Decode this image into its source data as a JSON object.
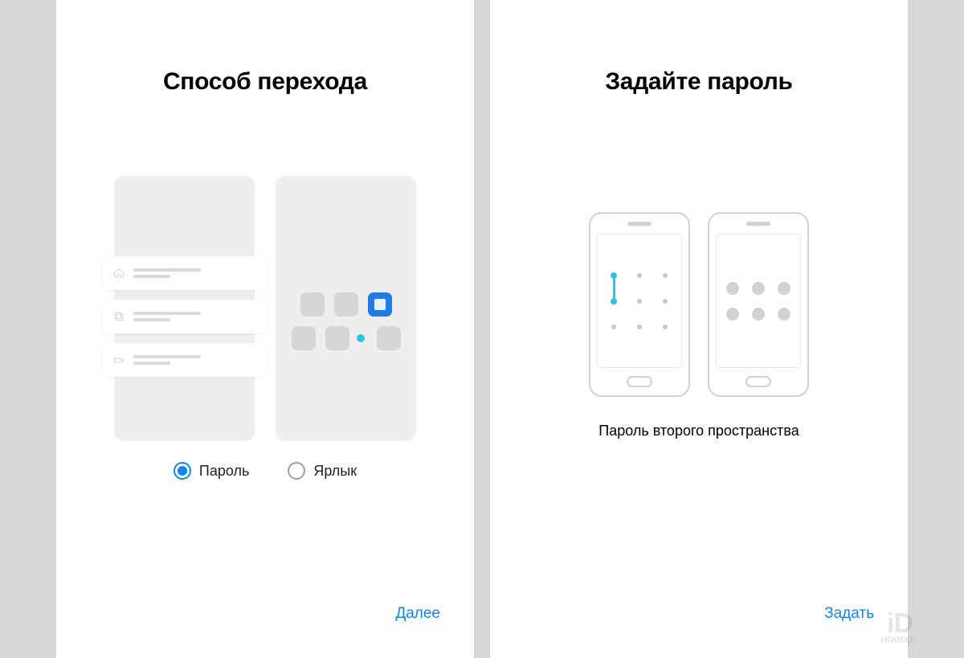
{
  "screen1": {
    "title": "Способ перехода",
    "options": {
      "password": "Пароль",
      "shortcut": "Ярлык"
    },
    "selected": "password",
    "action": "Далее"
  },
  "screen2": {
    "title": "Задайте пароль",
    "subtitle": "Пароль второго пространства",
    "action": "Задать"
  },
  "watermark": {
    "big": "iD",
    "small": "игатор"
  }
}
